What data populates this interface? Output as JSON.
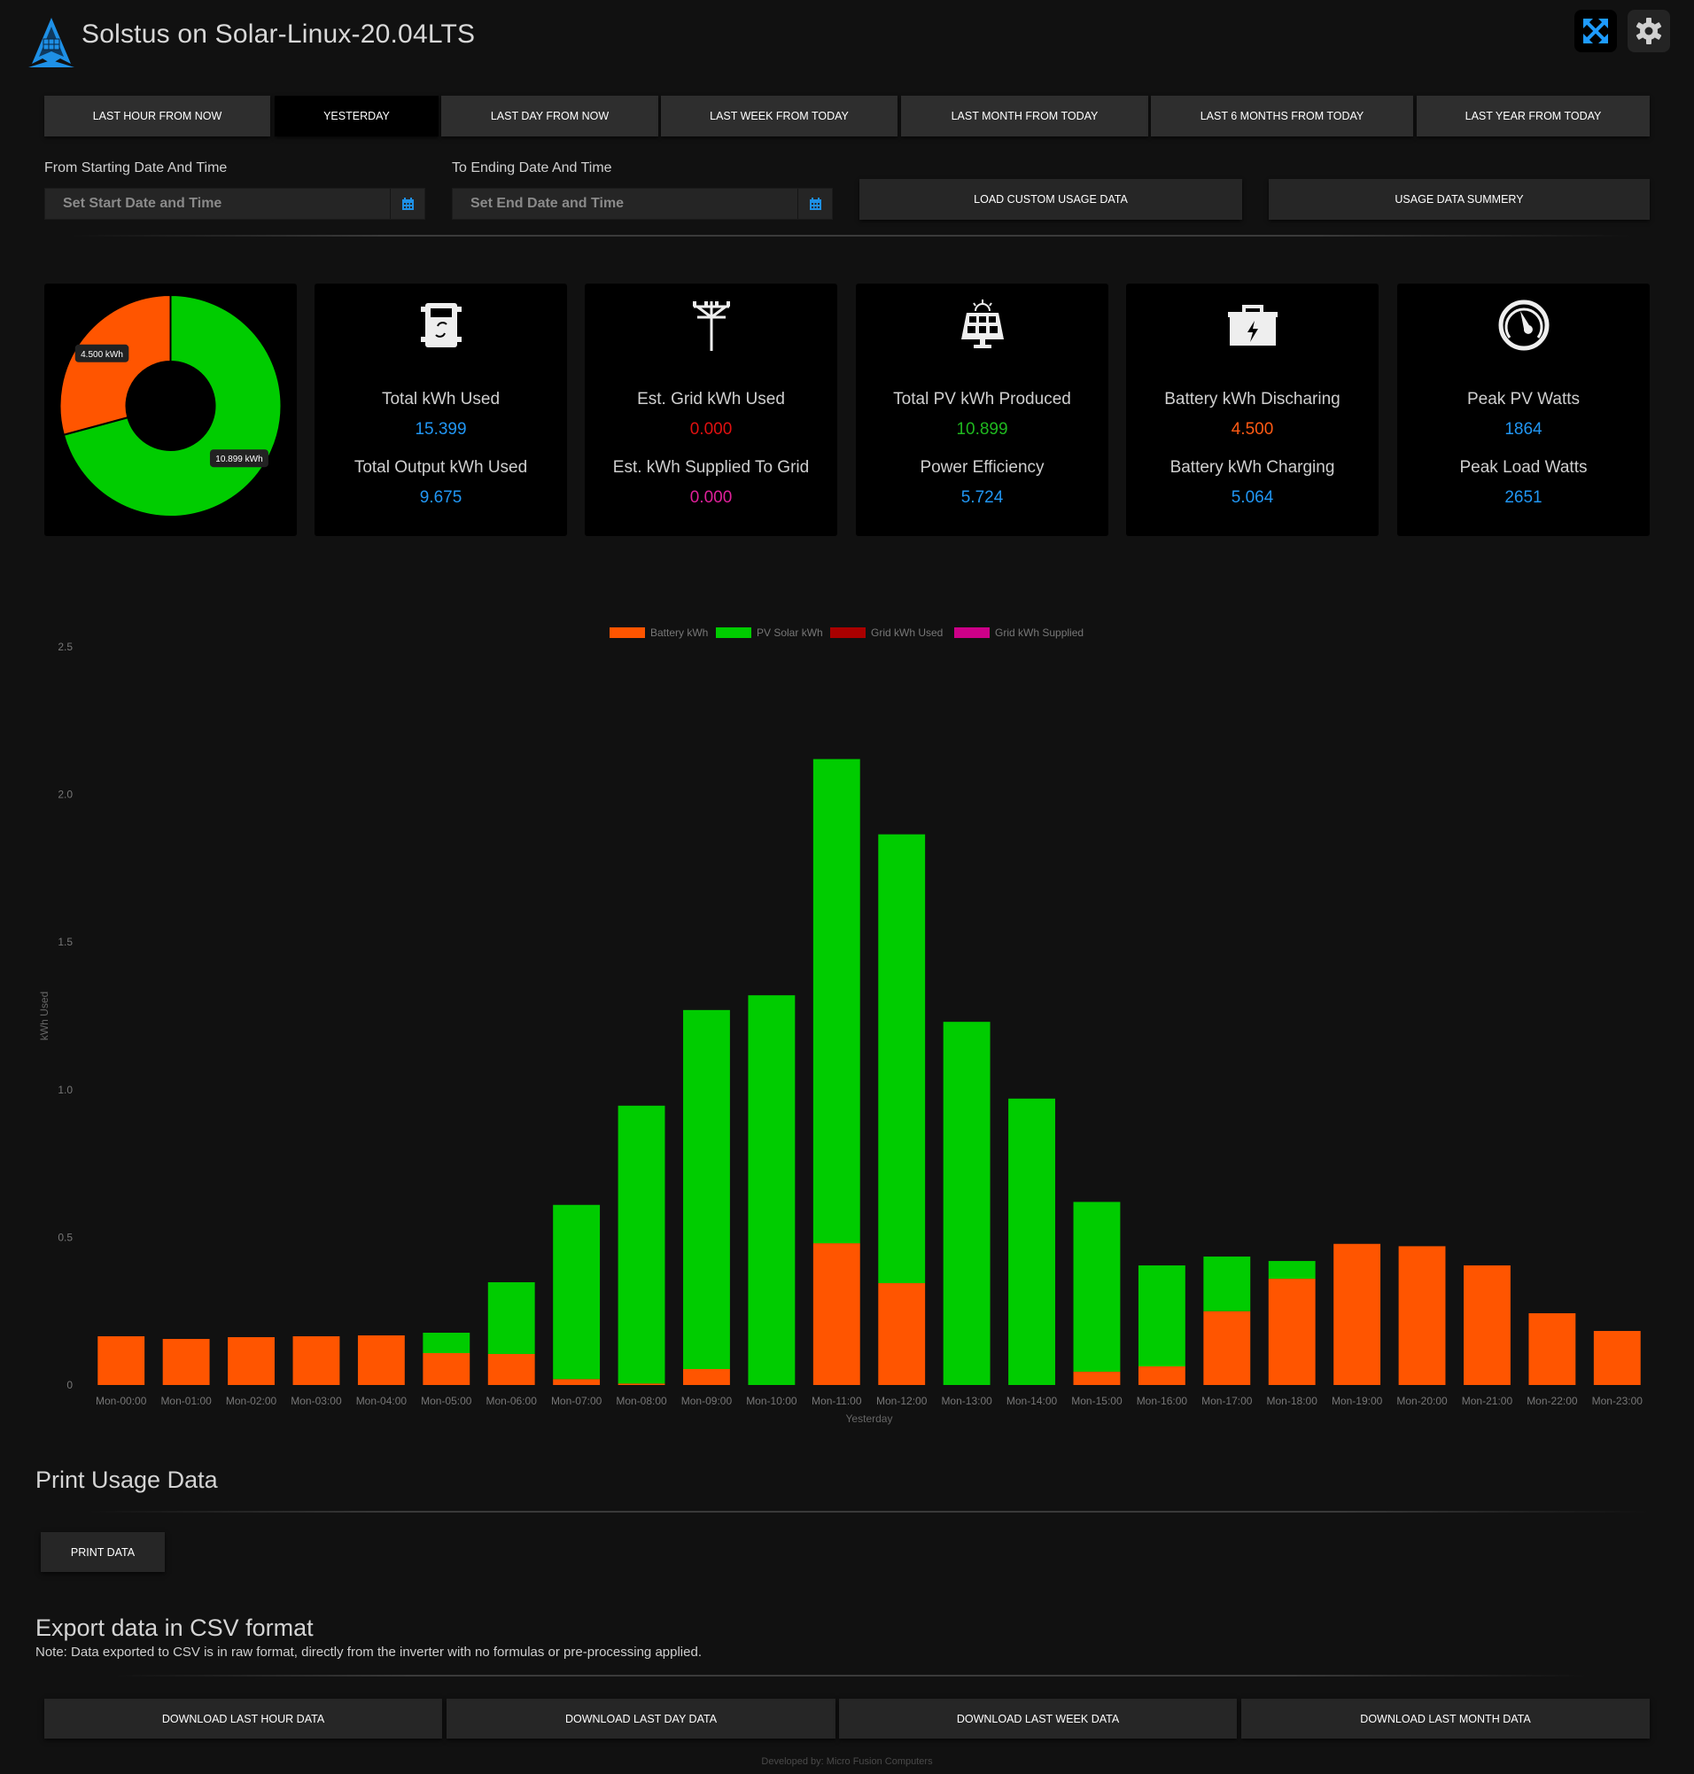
{
  "header": {
    "title": "Solstus on Solar-Linux-20.04LTS",
    "fullscreen_icon": "expand-arrows-icon",
    "settings_icon": "gear-icon"
  },
  "tabs": [
    {
      "label": "LAST HOUR FROM NOW",
      "active": false
    },
    {
      "label": "YESTERDAY",
      "active": true
    },
    {
      "label": "LAST DAY FROM NOW",
      "active": false
    },
    {
      "label": "LAST WEEK FROM TODAY",
      "active": false
    },
    {
      "label": "LAST MONTH FROM TODAY",
      "active": false
    },
    {
      "label": "LAST 6 MONTHS FROM TODAY",
      "active": false
    },
    {
      "label": "LAST YEAR FROM TODAY",
      "active": false
    }
  ],
  "custom_range": {
    "start_label": "From Starting Date And Time",
    "start_placeholder": "Set Start Date and Time",
    "start_value": "",
    "end_label": "To Ending Date And Time",
    "end_placeholder": "Set End Date and Time",
    "end_value": "",
    "calendar_icon": "calendar-icon",
    "load_button": "LOAD CUSTOM USAGE DATA",
    "summary_button": "USAGE DATA SUMMERY"
  },
  "donut": {
    "slices": [
      {
        "name": "Battery kWh",
        "value": 4.5,
        "label": "4.500 kWh",
        "color": "#ff5500"
      },
      {
        "name": "PV Solar kWh",
        "value": 10.899,
        "label": "10.899 kWh",
        "color": "#00cc00"
      }
    ]
  },
  "cards": [
    {
      "icon": "inverter-icon",
      "label1": "Total kWh Used",
      "value1": "15.399",
      "color1": "#2196f3",
      "label2": "Total Output kWh Used",
      "value2": "9.675",
      "color2": "#2196f3"
    },
    {
      "icon": "power-pole-icon",
      "label1": "Est. Grid kWh Used",
      "value1": "0.000",
      "color1": "#e01010",
      "label2": "Est. kWh Supplied To Grid",
      "value2": "0.000",
      "color2": "#e0209a"
    },
    {
      "icon": "solar-panel-icon",
      "label1": "Total PV kWh Produced",
      "value1": "10.899",
      "color1": "#1fb81f",
      "label2": "Power Efficiency",
      "value2": "5.724",
      "color2": "#2196f3"
    },
    {
      "icon": "battery-icon",
      "label1": "Battery kWh Discharing",
      "value1": "4.500",
      "color1": "#ff5a14",
      "label2": "Battery kWh Charging",
      "value2": "5.064",
      "color2": "#2196f3"
    },
    {
      "icon": "gauge-icon",
      "label1": "Peak PV Watts",
      "value1": "1864",
      "color1": "#2196f3",
      "label2": "Peak Load Watts",
      "value2": "2651",
      "color2": "#2196f3"
    }
  ],
  "chart_data": {
    "type": "bar",
    "stacked": true,
    "title": "",
    "xlabel": "Yesterday",
    "ylabel": "kWh Used",
    "ylim": [
      0,
      2.5
    ],
    "yticks": [
      "0",
      "0.5",
      "1.0",
      "1.5",
      "2.0",
      "2.5"
    ],
    "ytick_values": [
      0,
      0.5,
      1.0,
      1.5,
      2.0,
      2.5
    ],
    "grid": false,
    "legend_position": "top",
    "categories": [
      "Mon-00:00",
      "Mon-01:00",
      "Mon-02:00",
      "Mon-03:00",
      "Mon-04:00",
      "Mon-05:00",
      "Mon-06:00",
      "Mon-07:00",
      "Mon-08:00",
      "Mon-09:00",
      "Mon-10:00",
      "Mon-11:00",
      "Mon-12:00",
      "Mon-13:00",
      "Mon-14:00",
      "Mon-15:00",
      "Mon-16:00",
      "Mon-17:00",
      "Mon-18:00",
      "Mon-19:00",
      "Mon-20:00",
      "Mon-21:00",
      "Mon-22:00",
      "Mon-23:00"
    ],
    "series": [
      {
        "name": "Battery kWh",
        "color": "#ff5500",
        "values": [
          0.165,
          0.156,
          0.162,
          0.165,
          0.168,
          0.108,
          0.105,
          0.02,
          0.005,
          0.054,
          0,
          0.48,
          0.345,
          0,
          0,
          0.045,
          0.063,
          0.25,
          0.36,
          0.478,
          0.47,
          0.405,
          0.243,
          0.183
        ]
      },
      {
        "name": "PV Solar kWh",
        "color": "#00cc00",
        "values": [
          0,
          0,
          0,
          0,
          0,
          0.069,
          0.243,
          0.59,
          0.941,
          1.216,
          1.32,
          1.64,
          1.52,
          1.23,
          0.97,
          0.575,
          0.342,
          0.185,
          0.06,
          0,
          0,
          0,
          0,
          0
        ]
      },
      {
        "name": "Grid kWh Used",
        "color": "#aa0000",
        "values": [
          0,
          0,
          0,
          0,
          0,
          0,
          0,
          0,
          0,
          0,
          0,
          0,
          0,
          0,
          0,
          0,
          0,
          0,
          0,
          0,
          0,
          0,
          0,
          0
        ]
      },
      {
        "name": "Grid kWh Supplied",
        "color": "#cc0088",
        "values": [
          0,
          0,
          0,
          0,
          0,
          0,
          0,
          0,
          0,
          0,
          0,
          0,
          0,
          0,
          0,
          0,
          0,
          0,
          0,
          0,
          0,
          0,
          0,
          0
        ]
      }
    ]
  },
  "print_section": {
    "title": "Print Usage Data",
    "button": "PRINT DATA"
  },
  "export_section": {
    "title": "Export data in CSV format",
    "note": "Note: Data exported to CSV is in raw format, directly from the inverter with no formulas or pre-processing applied.",
    "buttons": [
      "DOWNLOAD LAST HOUR DATA",
      "DOWNLOAD LAST DAY DATA",
      "DOWNLOAD LAST WEEK DATA",
      "DOWNLOAD LAST MONTH DATA"
    ]
  },
  "footer": "Developed by: Micro Fusion Computers"
}
